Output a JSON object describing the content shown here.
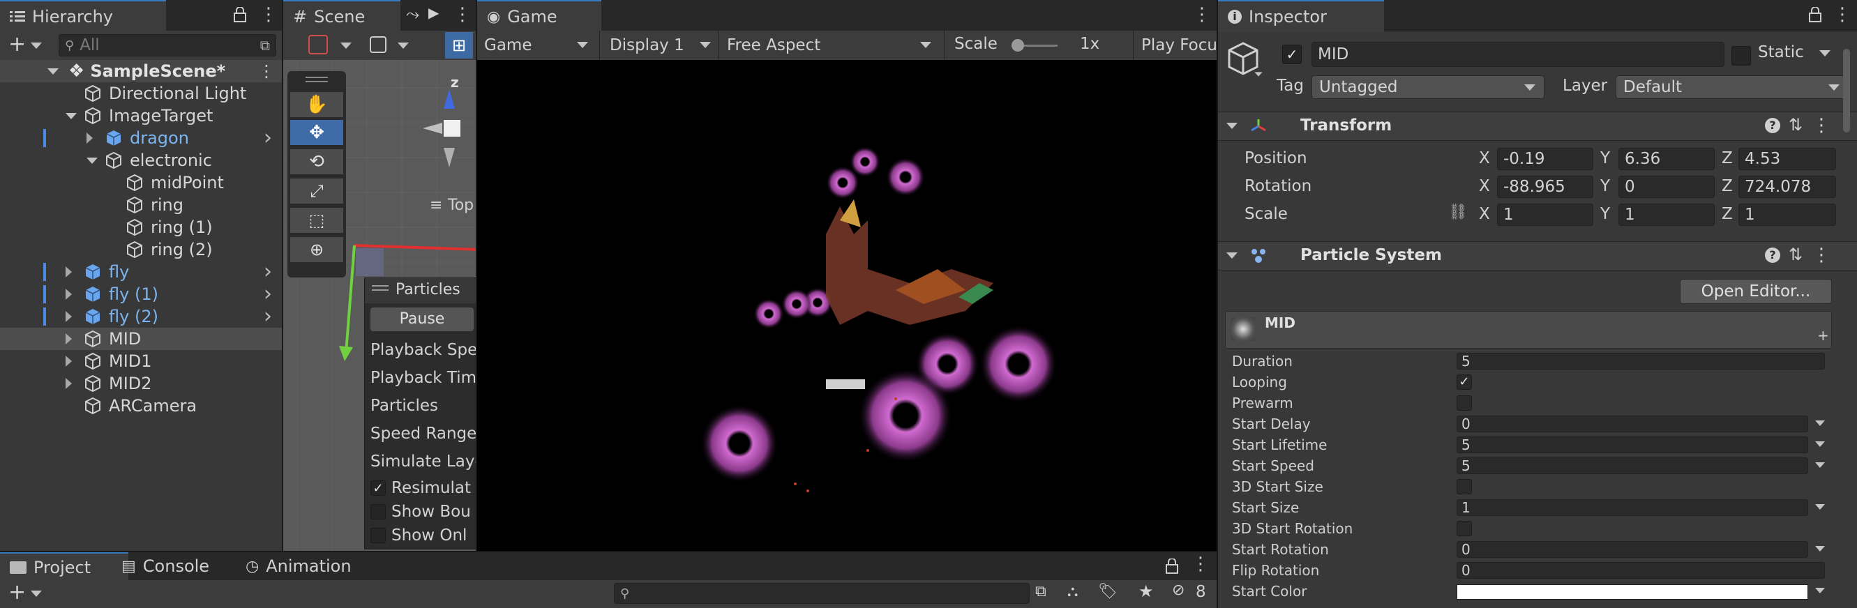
{
  "hierarchy": {
    "title": "Hierarchy",
    "search_placeholder": "All",
    "scene": "SampleScene*",
    "items": [
      {
        "label": "Directional Light"
      },
      {
        "label": "ImageTarget"
      },
      {
        "label": "dragon"
      },
      {
        "label": "electronic"
      },
      {
        "label": "midPoint"
      },
      {
        "label": "ring"
      },
      {
        "label": "ring (1)"
      },
      {
        "label": "ring (2)"
      },
      {
        "label": "fly"
      },
      {
        "label": "fly (1)"
      },
      {
        "label": "fly (2)"
      },
      {
        "label": "MID"
      },
      {
        "label": "MID1"
      },
      {
        "label": "MID2"
      },
      {
        "label": "ARCamera"
      }
    ]
  },
  "scene_view": {
    "tab": "Scene",
    "axis_z": "z",
    "view_label": "Top",
    "particles_overlay": {
      "title": "Particles",
      "pause": "Pause",
      "rows": [
        "Playback Spe",
        "Playback Tim",
        "Particles",
        "Speed Range",
        "Simulate Laye"
      ],
      "checks": [
        {
          "label": "Resimulat",
          "checked": true
        },
        {
          "label": "Show Bou",
          "checked": false
        },
        {
          "label": "Show Onl",
          "checked": false
        }
      ]
    }
  },
  "game_view": {
    "tab": "Game",
    "display_mode": "Game",
    "display": "Display 1",
    "aspect": "Free Aspect",
    "scale_label": "Scale",
    "scale_value": "1x",
    "play_mode": "Play Focuse"
  },
  "inspector": {
    "title": "Inspector",
    "object_name": "MID",
    "active": true,
    "static_label": "Static",
    "tag_label": "Tag",
    "tag_value": "Untagged",
    "layer_label": "Layer",
    "layer_value": "Default",
    "transform": {
      "title": "Transform",
      "position": {
        "label": "Position",
        "x": "-0.19",
        "y": "6.36",
        "z": "4.53"
      },
      "rotation": {
        "label": "Rotation",
        "x": "-88.965",
        "y": "0",
        "z": "724.078"
      },
      "scale": {
        "label": "Scale",
        "x": "1",
        "y": "1",
        "z": "1"
      }
    },
    "particle_system": {
      "title": "Particle System",
      "open_editor": "Open Editor...",
      "module_name": "MID",
      "props": {
        "duration": {
          "label": "Duration",
          "value": "5"
        },
        "looping": {
          "label": "Looping",
          "checked": true
        },
        "prewarm": {
          "label": "Prewarm",
          "checked": false
        },
        "start_delay": {
          "label": "Start Delay",
          "value": "0"
        },
        "start_lifetime": {
          "label": "Start Lifetime",
          "value": "5"
        },
        "start_speed": {
          "label": "Start Speed",
          "value": "5"
        },
        "start_size_3d": {
          "label": "3D Start Size",
          "checked": false
        },
        "start_size": {
          "label": "Start Size",
          "value": "1"
        },
        "start_rotation_3d": {
          "label": "3D Start Rotation",
          "checked": false
        },
        "start_rotation": {
          "label": "Start Rotation",
          "value": "0"
        },
        "flip_rotation": {
          "label": "Flip Rotation",
          "value": "0"
        },
        "start_color": {
          "label": "Start Color",
          "value": "#ffffff"
        }
      }
    }
  },
  "bottom": {
    "tabs": [
      "Project",
      "Console",
      "Animation"
    ],
    "hidden_count": "8"
  },
  "colors": {
    "accent": "#3a79bb",
    "prefab": "#7cb4f0",
    "panel": "#383838",
    "tab_bar": "#282828"
  }
}
